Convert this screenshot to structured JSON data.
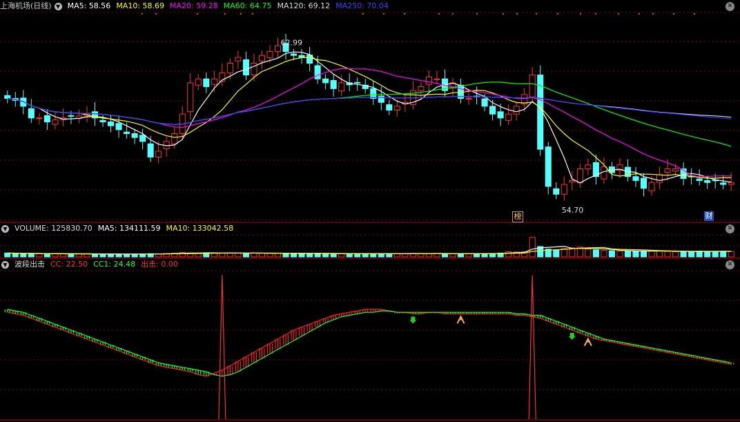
{
  "main": {
    "title": "上海机场(日线)",
    "ma5": "MA5: 58.56",
    "ma10": "MA10: 58.69",
    "ma20": "MA20: 59.28",
    "ma60": "MA60: 64.75",
    "ma120": "MA120: 69.12",
    "ma250": "MA250: 70.04",
    "high_label": "62.99",
    "low_label": "54.70",
    "badge_bang": "榜",
    "badge_cai": "财"
  },
  "volume": {
    "title": "VOLUME: 125830.70",
    "ma5": "MA5: 134111.59",
    "ma10": "MA10: 133042.58"
  },
  "indicator": {
    "title": "波段出击",
    "cc": "CC: 22.50",
    "cc1": "CC1: 24.48",
    "chuji": "出击: 0.00"
  },
  "colors": {
    "background": "#000000",
    "up": "#ff3232",
    "down": "#54ffff",
    "ma5": "#ffffff",
    "ma10": "#ffff00",
    "ma20": "#ff00ff",
    "ma60": "#00ff00",
    "ma120": "#e0e0e0",
    "ma250": "#3030ff",
    "grid": "#8b0000",
    "ind_up": "#ff2020",
    "ind_down": "#20ff20"
  },
  "chart_data": {
    "type": "candlestick",
    "main_panel": {
      "ylim": [
        54,
        64.6
      ],
      "high": 62.99,
      "low": 54.7,
      "closes": [
        60.2,
        60.1,
        59.8,
        59.2,
        59.2,
        59.0,
        59.1,
        59.2,
        59.3,
        59.3,
        59.4,
        59.2,
        59.0,
        58.8,
        58.6,
        58.4,
        58.2,
        58.0,
        57.2,
        57.5,
        58.0,
        58.4,
        59.4,
        61.0,
        61.2,
        60.8,
        61.2,
        61.5,
        62.0,
        62.3,
        61.4,
        62.0,
        62.4,
        62.6,
        62.9,
        62.6,
        62.4,
        62.3,
        62.0,
        61.2,
        61.0,
        60.7,
        61.0,
        60.9,
        61.0,
        60.7,
        60.2,
        60.0,
        59.6,
        59.8,
        60.0,
        60.6,
        60.8,
        61.3,
        61.2,
        60.6,
        61.0,
        60.2,
        60.2,
        60.3,
        59.8,
        59.4,
        59.2,
        59.4,
        59.8,
        60.4,
        61.4,
        57.6,
        55.7,
        55.3,
        55.8,
        56.0,
        56.6,
        56.8,
        56.2,
        56.7,
        56.4,
        56.8,
        56.2,
        56.0,
        55.6,
        55.9,
        56.3,
        56.6,
        56.6,
        56.1,
        56.2,
        56.0,
        55.9,
        56.0,
        55.8,
        55.9
      ]
    },
    "volume_panel": {
      "ylim": [
        0,
        340000
      ],
      "values": [
        60000,
        55000,
        50000,
        52000,
        48000,
        50000,
        47000,
        45000,
        48000,
        46000,
        44000,
        45000,
        43000,
        47000,
        42000,
        44000,
        43000,
        46000,
        50000,
        48000,
        52000,
        58000,
        70000,
        62000,
        60000,
        65000,
        58000,
        60000,
        63000,
        57000,
        55000,
        60000,
        58000,
        54000,
        56000,
        55000,
        52000,
        50000,
        54000,
        56000,
        52000,
        50000,
        48000,
        51000,
        53000,
        50000,
        47000,
        49000,
        52000,
        50000,
        53000,
        56000,
        52000,
        50000,
        55000,
        52000,
        50000,
        49000,
        47000,
        50000,
        52000,
        54000,
        60000,
        80000,
        76000,
        82000,
        300000,
        160000,
        120000,
        110000,
        130000,
        140000,
        150000,
        120000,
        110000,
        100000,
        95000,
        90000,
        85000,
        88000,
        92000,
        95000,
        90000,
        85000,
        80000,
        82000,
        84000,
        90000,
        86000,
        80000,
        88000,
        84000
      ],
      "ma5": 134111.59,
      "ma10": 133042.58
    },
    "indicator_panel": {
      "name": "波段出击",
      "ylim": [
        0,
        100
      ],
      "cc": [
        72,
        71,
        70,
        68,
        66,
        64,
        62,
        60,
        58,
        56,
        54,
        52,
        50,
        48,
        46,
        44,
        42,
        40,
        38,
        36,
        35,
        34,
        33,
        32,
        30,
        29,
        31,
        33,
        36,
        39,
        42,
        45,
        48,
        51,
        54,
        57,
        60,
        62,
        64,
        66,
        68,
        70,
        71,
        72,
        73,
        74,
        74,
        74,
        73,
        72,
        72,
        71,
        71,
        72,
        72,
        71,
        71,
        71,
        71,
        71,
        71,
        71,
        71,
        71,
        70,
        70,
        69,
        68,
        66,
        64,
        62,
        60,
        58,
        56,
        54,
        53,
        52,
        51,
        50,
        49,
        48,
        47,
        46,
        45,
        44,
        43,
        42,
        41,
        40,
        39,
        38,
        37
      ],
      "cc1": [
        74,
        73,
        72,
        70,
        68,
        66,
        64,
        62,
        60,
        58,
        56,
        54,
        52,
        50,
        48,
        46,
        44,
        42,
        40,
        38,
        37,
        36,
        35,
        34,
        33,
        32,
        30,
        29,
        30,
        32,
        35,
        38,
        41,
        44,
        47,
        50,
        53,
        56,
        59,
        62,
        65,
        67,
        69,
        70,
        71,
        72,
        72,
        73,
        73,
        72,
        72,
        72,
        72,
        72,
        72,
        72,
        72,
        72,
        72,
        72,
        72,
        72,
        72,
        72,
        71,
        71,
        70,
        70,
        68,
        66,
        64,
        62,
        60,
        58,
        56,
        54,
        53,
        52,
        51,
        50,
        49,
        48,
        47,
        46,
        45,
        44,
        43,
        42,
        41,
        40,
        39,
        38
      ],
      "signal_indices": [
        27,
        66
      ],
      "signal_peak": 97,
      "down_arrow_indices": [
        51,
        71
      ],
      "up_marker_indices": [
        57,
        73
      ]
    }
  }
}
